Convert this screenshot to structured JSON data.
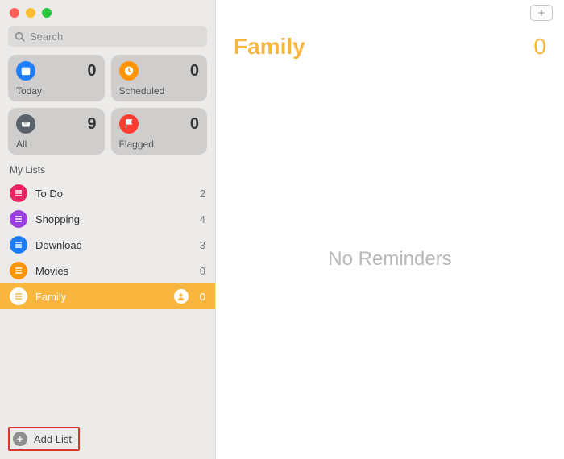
{
  "search": {
    "placeholder": "Search"
  },
  "smart": {
    "today": {
      "label": "Today",
      "count": 0,
      "color": "#1f7ef7"
    },
    "scheduled": {
      "label": "Scheduled",
      "count": 0,
      "color": "#ff9502"
    },
    "all": {
      "label": "All",
      "count": 9,
      "color": "#5a636b"
    },
    "flagged": {
      "label": "Flagged",
      "count": 0,
      "color": "#ff3b30"
    }
  },
  "sections": {
    "mylists": "My Lists"
  },
  "lists": [
    {
      "label": "To Do",
      "count": 2,
      "color": "#e62664"
    },
    {
      "label": "Shopping",
      "count": 4,
      "color": "#9b3ee0"
    },
    {
      "label": "Download",
      "count": 3,
      "color": "#1f7ef7"
    },
    {
      "label": "Movies",
      "count": 0,
      "color": "#ff9502"
    },
    {
      "label": "Family",
      "count": 0,
      "color": "#f8b63e",
      "selected": true,
      "shared": true
    }
  ],
  "bottom": {
    "add_list": "Add List"
  },
  "main": {
    "title": "Family",
    "count": 0,
    "empty": "No Reminders",
    "accent": "#f8b63e"
  }
}
